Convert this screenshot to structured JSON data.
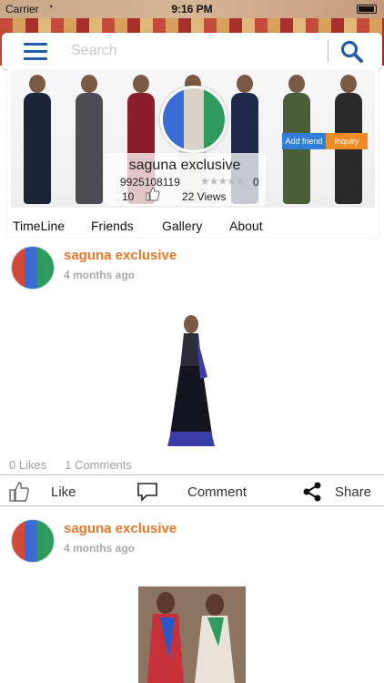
{
  "status_bar": {
    "carrier": "Carrier",
    "time": "9:16 PM"
  },
  "search": {
    "placeholder": "Search"
  },
  "profile": {
    "name": "saguna exclusive",
    "phone": "9925108119",
    "stars": "★★★★★",
    "rating": "0",
    "likes": "10",
    "views": "22 Views",
    "add_friend_label": "Add friend",
    "inquiry_label": "Inquiry"
  },
  "tabs": [
    "TimeLine",
    "Friends",
    "Gallery",
    "About"
  ],
  "posts": [
    {
      "author": "saguna exclusive",
      "time": "4 months ago",
      "likes": "0 Likes",
      "comments": "1 Comments",
      "like_label": "Like",
      "comment_label": "Comment",
      "share_label": "Share"
    },
    {
      "author": "saguna exclusive",
      "time": "4 months ago"
    }
  ],
  "colors": {
    "accent_blue": "#1f5da8",
    "author_orange": "#e37829",
    "add_friend": "#2f7fd8",
    "inquiry": "#f08a24"
  },
  "icons": [
    "menu-icon",
    "search-icon",
    "thumbs-up-icon",
    "comment-icon",
    "share-icon"
  ]
}
